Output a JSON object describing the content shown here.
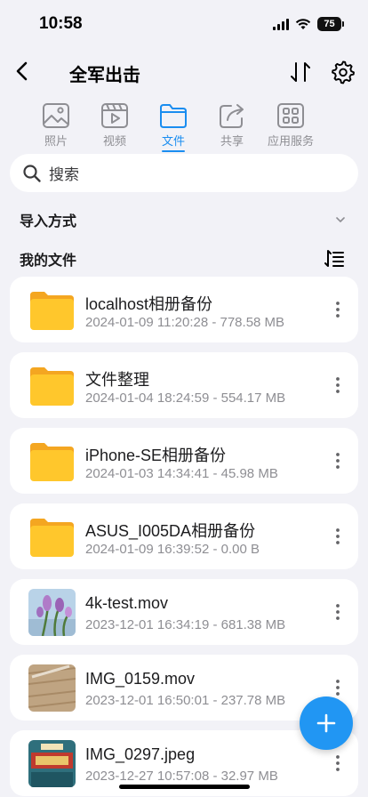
{
  "status": {
    "time": "10:58",
    "battery": "75"
  },
  "header": {
    "title": "全军出击"
  },
  "tabs": [
    {
      "label": "照片",
      "icon": "photo-icon",
      "active": false
    },
    {
      "label": "视频",
      "icon": "video-icon",
      "active": false
    },
    {
      "label": "文件",
      "icon": "folder-icon",
      "active": true
    },
    {
      "label": "共享",
      "icon": "share-icon",
      "active": false
    },
    {
      "label": "应用服务",
      "icon": "apps-icon",
      "active": false
    }
  ],
  "search": {
    "placeholder": "搜索"
  },
  "import": {
    "label": "导入方式"
  },
  "files": {
    "label": "我的文件",
    "items": [
      {
        "name": "localhost相册备份",
        "meta": "2024-01-09 11:20:28 - 778.58 MB",
        "kind": "folder"
      },
      {
        "name": "文件整理",
        "meta": "2024-01-04 18:24:59 - 554.17 MB",
        "kind": "folder"
      },
      {
        "name": "iPhone-SE相册备份",
        "meta": "2024-01-03 14:34:41 - 45.98 MB",
        "kind": "folder"
      },
      {
        "name": "ASUS_I005DA相册备份",
        "meta": "2024-01-09 16:39:52 - 0.00 B",
        "kind": "folder"
      },
      {
        "name": "4k-test.mov",
        "meta": "2023-12-01 16:34:19 - 681.38 MB",
        "kind": "video-flowers"
      },
      {
        "name": "IMG_0159.mov",
        "meta": "2023-12-01 16:50:01 - 237.78 MB",
        "kind": "video-wood"
      },
      {
        "name": "IMG_0297.jpeg",
        "meta": "2023-12-27 10:57:08 - 32.97 MB",
        "kind": "image-sign"
      }
    ]
  },
  "colors": {
    "accent": "#1a8df0",
    "fab": "#2196f3",
    "folder": "#ffc72c"
  }
}
